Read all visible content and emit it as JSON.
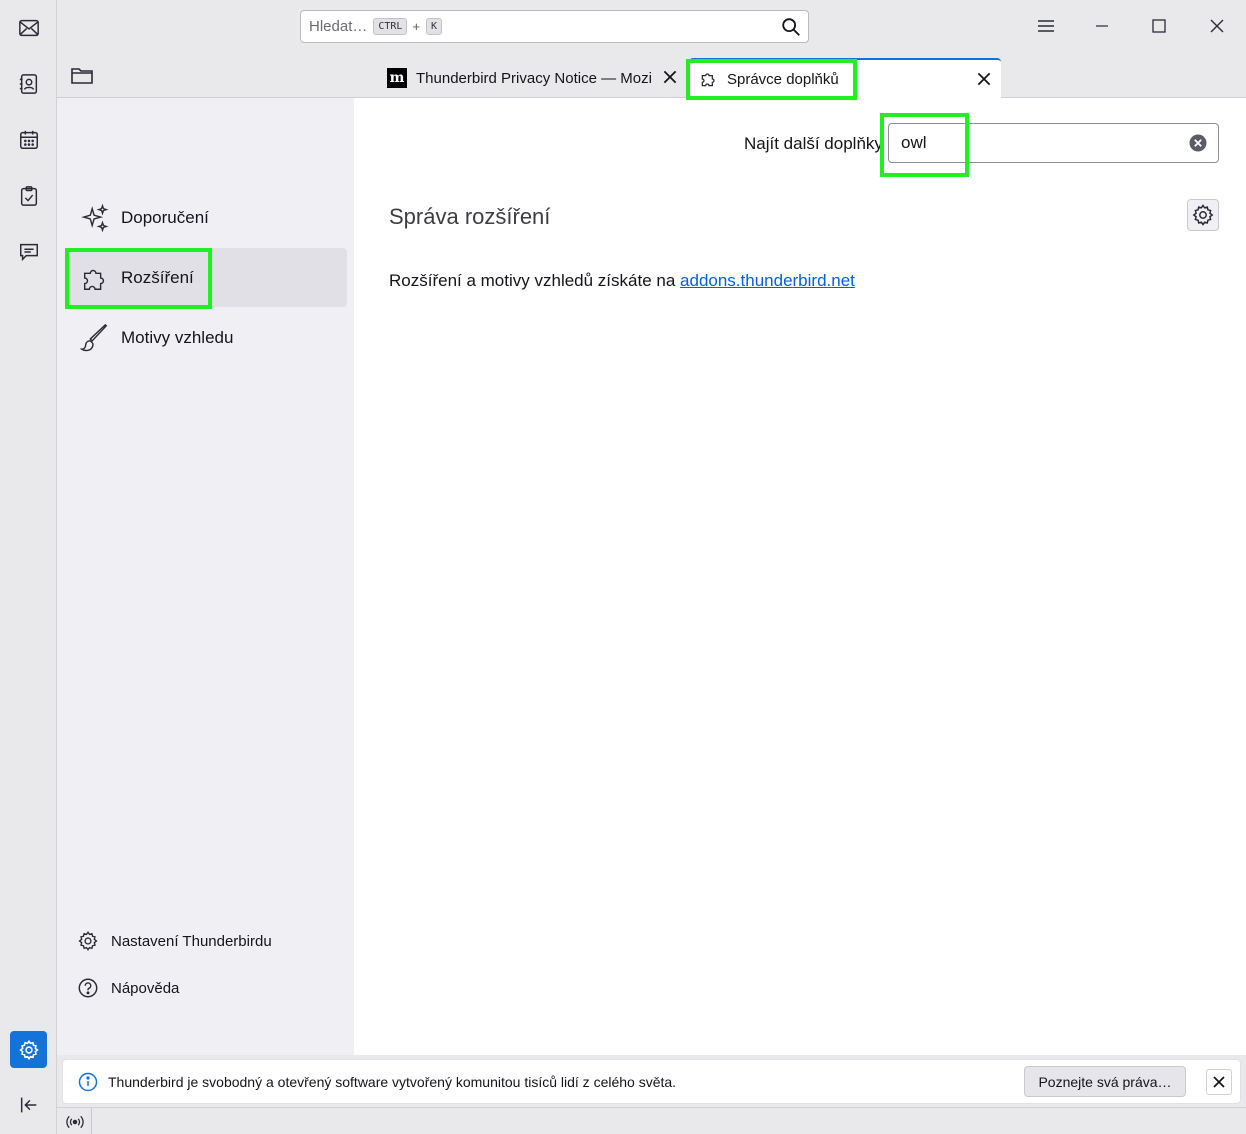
{
  "search": {
    "placeholder": "Hledat…",
    "shortcut_mod": "CTRL",
    "shortcut_plus": "+",
    "shortcut_key": "K"
  },
  "spaces": [
    "mail-icon",
    "address-book-icon",
    "calendar-icon",
    "tasks-icon",
    "chat-icon"
  ],
  "tabs": [
    {
      "label": "Thunderbird Privacy Notice — Mozilla",
      "icon": "mozilla-m-logo"
    },
    {
      "label": "Správce doplňků",
      "icon": "puzzle-icon",
      "active": true
    }
  ],
  "sidebar": {
    "categories": [
      {
        "label": "Doporučení",
        "icon": "sparkles-icon"
      },
      {
        "label": "Rozšíření",
        "icon": "puzzle-icon",
        "selected": true
      },
      {
        "label": "Motivy vzhledu",
        "icon": "brush-icon"
      }
    ],
    "bottom": [
      {
        "label": "Nastavení Thunderbirdu",
        "icon": "gear-icon"
      },
      {
        "label": "Nápověda",
        "icon": "help-icon"
      }
    ]
  },
  "main": {
    "find_label": "Najít další doplňky",
    "find_value": "owl",
    "heading": "Správa rozšíření",
    "info_text": "Rozšíření a motivy vzhledů získáte na ",
    "info_link": "addons.thunderbird.net"
  },
  "notification": {
    "message": "Thunderbird je svobodný a otevřený software vytvořený komunitou tisíců lidí z celého světa.",
    "button": "Poznejte svá práva…"
  },
  "colors": {
    "accent": "#1373d9",
    "highlight": "#22ee22",
    "link": "#0061e0"
  }
}
